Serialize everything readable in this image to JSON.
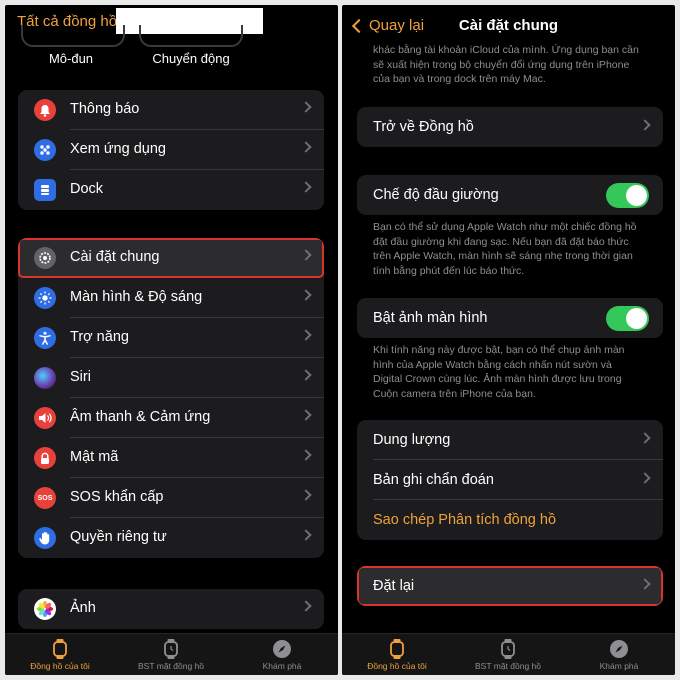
{
  "left": {
    "header": {
      "title": "Tất cả đồng hồ"
    },
    "top_buttons": [
      "Mô-đun",
      "Chuyển động"
    ],
    "group1": [
      {
        "label": "Thông báo",
        "icon": "bell-icon",
        "color": "#e8413c"
      },
      {
        "label": "Xem ứng dụng",
        "icon": "app-grid-icon",
        "color": "#2f6de4"
      },
      {
        "label": "Dock",
        "icon": "dock-icon",
        "color": "#2f6de4"
      }
    ],
    "group2": [
      {
        "label": "Cài đặt chung",
        "icon": "gear-icon",
        "color": "#8e8e93"
      },
      {
        "label": "Màn hình & Độ sáng",
        "icon": "sun-icon",
        "color": "#2f6de4"
      },
      {
        "label": "Trợ năng",
        "icon": "accessibility-icon",
        "color": "#2f6de4"
      },
      {
        "label": "Siri",
        "icon": "siri-icon",
        "color": "#6b3fb0"
      },
      {
        "label": "Âm thanh & Cảm ứng",
        "icon": "speaker-icon",
        "color": "#e8413c"
      },
      {
        "label": "Mật mã",
        "icon": "lock-icon",
        "color": "#e8413c"
      },
      {
        "label": "SOS khẩn cấp",
        "icon": "sos-icon",
        "color": "#e8413c",
        "glyph": "SOS"
      },
      {
        "label": "Quyền riêng tư",
        "icon": "hand-icon",
        "color": "#2f6de4"
      }
    ],
    "group3": [
      {
        "label": "Ảnh",
        "icon": "photos-icon",
        "color": "#ffffff"
      }
    ],
    "tabs": [
      {
        "label": "Đồng hồ của tôi",
        "icon": "watch-icon"
      },
      {
        "label": "BST mặt đồng hồ",
        "icon": "watch-face-icon"
      },
      {
        "label": "Khám phá",
        "icon": "compass-icon"
      }
    ]
  },
  "right": {
    "header": {
      "back": "Quay lại",
      "title": "Cài đặt chung"
    },
    "top_desc": "khác bằng tài khoản iCloud của mình. Ứng dụng bạn cần sẽ xuất hiện trong bộ chuyển đổi ứng dụng trên iPhone của bạn và trong dock trên máy Mac.",
    "return_clock": "Trở về Đồng hồ",
    "nightstand": {
      "label": "Chế độ đầu giường",
      "on": true,
      "desc": "Bạn có thể sử dụng Apple Watch như một chiếc đồng hồ đặt đầu giường khi đang sạc. Nếu bạn đã đặt báo thức trên Apple Watch, màn hình sẽ sáng nhẹ trong thời gian tính bằng phút đến lúc báo thức."
    },
    "screenshots": {
      "label": "Bật ảnh màn hình",
      "on": true,
      "desc": "Khi tính năng này được bật, bạn có thể chụp ảnh màn hình của Apple Watch bằng cách nhấn nút sườn và Digital Crown cùng lúc. Ảnh màn hình được lưu trong Cuộn camera trên iPhone của bạn."
    },
    "storage_group": {
      "storage": "Dung lượng",
      "diagnostics": "Bản ghi chẩn đoán",
      "copy_analytics": "Sao chép Phân tích đồng hồ"
    },
    "reset": "Đặt lại",
    "tabs": [
      {
        "label": "Đồng hồ của tôi",
        "icon": "watch-icon"
      },
      {
        "label": "BST mặt đồng hồ",
        "icon": "watch-face-icon"
      },
      {
        "label": "Khám phá",
        "icon": "compass-icon"
      }
    ]
  }
}
